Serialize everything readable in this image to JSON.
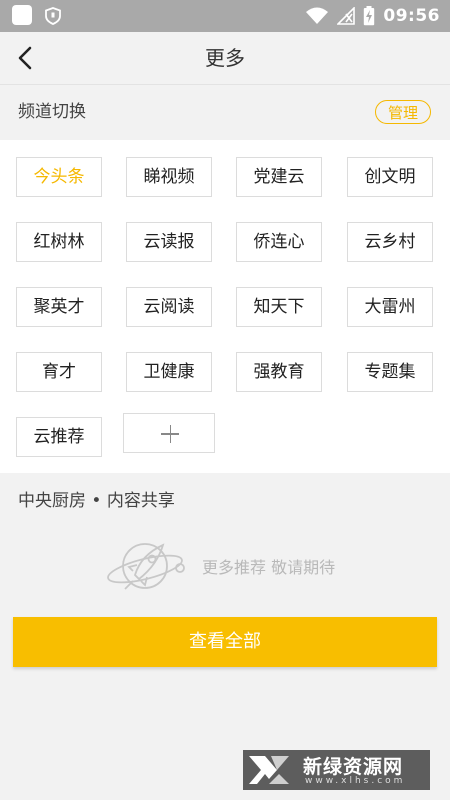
{
  "status_bar": {
    "time": "09:56",
    "icons": [
      "app-square-icon",
      "shield-icon",
      "wifi-icon",
      "no-signal-icon",
      "battery-charging-icon"
    ]
  },
  "header": {
    "title": "更多",
    "back_icon": "chevron-left-icon"
  },
  "channels": {
    "section_title": "频道切换",
    "manage_label": "管理",
    "items": [
      {
        "label": "今头条",
        "active": true
      },
      {
        "label": "睇视频",
        "active": false
      },
      {
        "label": "党建云",
        "active": false
      },
      {
        "label": "创文明",
        "active": false
      },
      {
        "label": "红树林",
        "active": false
      },
      {
        "label": "云读报",
        "active": false
      },
      {
        "label": "侨连心",
        "active": false
      },
      {
        "label": "云乡村",
        "active": false
      },
      {
        "label": "聚英才",
        "active": false
      },
      {
        "label": "云阅读",
        "active": false
      },
      {
        "label": "知天下",
        "active": false
      },
      {
        "label": "大雷州",
        "active": false
      },
      {
        "label": "育才",
        "active": false
      },
      {
        "label": "卫健康",
        "active": false
      },
      {
        "label": "强教育",
        "active": false
      },
      {
        "label": "专题集",
        "active": false
      },
      {
        "label": "云推荐",
        "active": false
      }
    ],
    "add_icon": "plus-icon"
  },
  "kitchen": {
    "title": "中央厨房 • 内容共享",
    "empty_text": "更多推荐 敬请期待",
    "empty_icon": "rocket-planet-icon"
  },
  "view_all_label": "查看全部",
  "watermark": {
    "text": "新绿资源网",
    "sub": "www.xlhs.com"
  },
  "colors": {
    "accent": "#f5b800",
    "button": "#f8be00",
    "status_bar": "#a9a9a9"
  }
}
